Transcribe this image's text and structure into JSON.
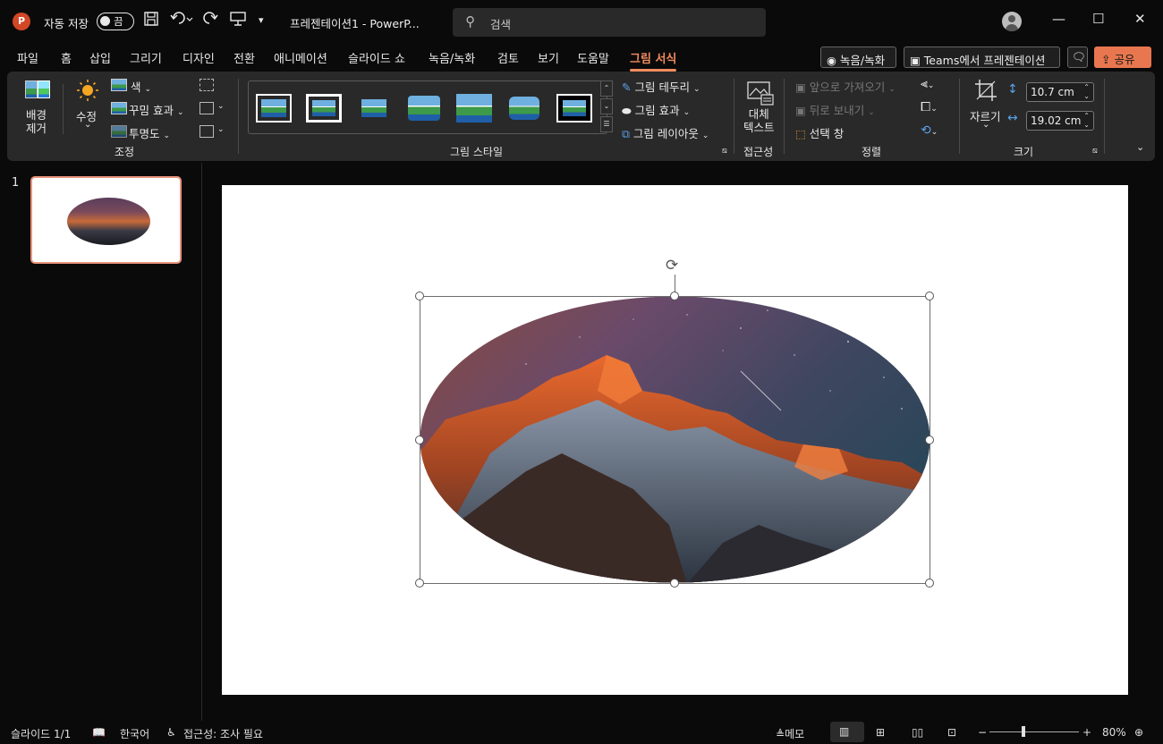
{
  "titlebar": {
    "autosave_label": "자동 저장",
    "autosave_state": "끔",
    "doc_title": "프레젠테이션1  -  PowerP...",
    "search_placeholder": "검색"
  },
  "menu": {
    "tabs": [
      "파일",
      "홈",
      "삽입",
      "그리기",
      "디자인",
      "전환",
      "애니메이션",
      "슬라이드 쇼",
      "녹음/녹화",
      "검토",
      "보기",
      "도움말",
      "그림 서식"
    ],
    "active_tab": "그림 서식",
    "record_label": "녹음/녹화",
    "teams_label": "Teams에서 프레젠테이션",
    "share_label": "공유"
  },
  "ribbon": {
    "remove_bg": [
      "배경",
      "제거"
    ],
    "corrections": "수정",
    "color": "색",
    "artistic_effects": "꾸밈 효과",
    "transparency": "투명도",
    "group_adjust": "조정",
    "group_styles": "그림 스타일",
    "picture_border": "그림 테두리",
    "picture_effects": "그림 효과",
    "picture_layout": "그림 레이아웃",
    "alt_text": [
      "대체",
      "텍스트"
    ],
    "group_accessibility": "접근성",
    "bring_forward": "앞으로 가져오기",
    "send_backward": "뒤로 보내기",
    "selection_pane": "선택 창",
    "group_arrange": "정렬",
    "crop": "자르기",
    "height": "10.7 cm",
    "width": "19.02 cm",
    "group_size": "크기"
  },
  "slides": {
    "number": "1"
  },
  "statusbar": {
    "slide_info": "슬라이드 1/1",
    "language": "한국어",
    "accessibility": "접근성: 조사 필요",
    "notes": "메모",
    "zoom": "80%"
  },
  "colors": {
    "accent": "#f28c5e",
    "share_bg": "#e8774f",
    "ribbon_bg": "#292929",
    "window_bg": "#0a0a0a"
  }
}
